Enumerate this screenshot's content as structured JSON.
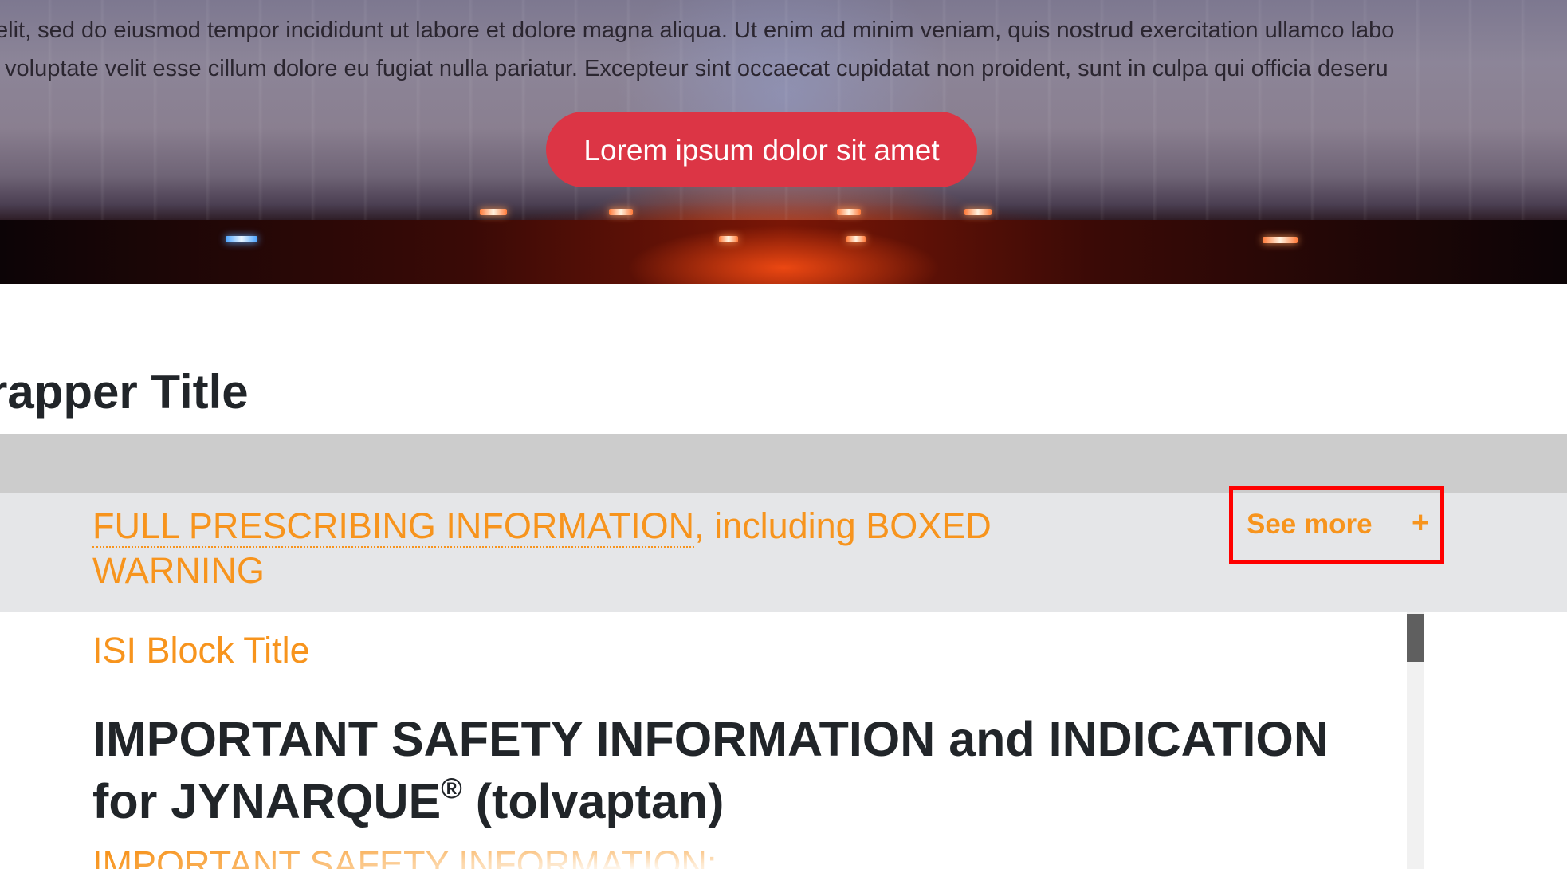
{
  "hero": {
    "text_line_1": "elit, sed do eiusmod tempor incididunt ut labore et dolore magna aliqua. Ut enim ad minim veniam, quis nostrud exercitation ullamco labo",
    "text_line_2": "voluptate velit esse cillum dolore eu fugiat nulla pariatur. Excepteur sint occaecat cupidatat non proident, sunt in culpa qui officia deseru",
    "cta_label": "Lorem ipsum dolor sit amet",
    "cta_color": "#dc3545"
  },
  "wrapper": {
    "title": "rapper Title"
  },
  "isi_header": {
    "link_text": "FULL PRESCRIBING INFORMATION",
    "trailing_text": ", including BOXED WARNING",
    "see_more_label": "See more",
    "see_more_icon": "+",
    "accent_color": "#f7941d",
    "highlight_color": "#ff0000"
  },
  "isi_content": {
    "block_title": "ISI Block Title",
    "heading_main": "IMPORTANT SAFETY INFORMATION and INDICATION for JYNARQUE",
    "heading_reg": "®",
    "heading_tail": " (tolvaptan)",
    "sub_heading": "IMPORTANT SAFETY INFORMATION:"
  }
}
